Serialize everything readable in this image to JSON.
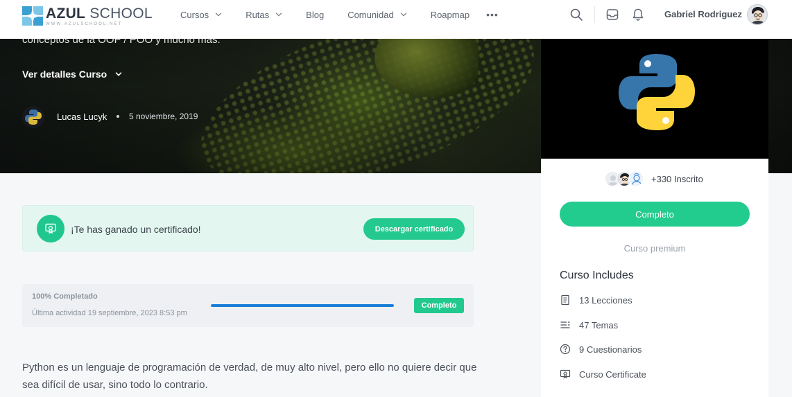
{
  "brand": {
    "name_bold": "AZUL",
    "name_light": "SCHOOL",
    "tagline": "WWW.AZULSCHOOL.NET"
  },
  "nav": {
    "items": [
      {
        "label": "Cursos",
        "has_dropdown": true
      },
      {
        "label": "Rutas",
        "has_dropdown": true
      },
      {
        "label": "Blog",
        "has_dropdown": false
      },
      {
        "label": "Comunidad",
        "has_dropdown": true
      },
      {
        "label": "Roapmap",
        "has_dropdown": false
      }
    ],
    "more": "•••"
  },
  "user": {
    "name": "Gabriel Rodriguez"
  },
  "hero": {
    "description": "conceptos de la OOP / POO y mucho mas.",
    "details_label": "Ver detalles Curso",
    "author": "Lucas Lucyk",
    "date": "5 noviembre, 2019"
  },
  "certificate": {
    "message": "¡Te has ganado un certificado!",
    "button": "Descargar certificado"
  },
  "progress": {
    "title": "100% Completado",
    "percent": 100,
    "last_activity": "Última actividad 19 septiembre, 2023 8:53 pm",
    "badge": "Completo"
  },
  "content": {
    "intro": "Python es un lenguaje de programación de verdad, de muy alto nivel, pero ello no quiere decir que sea difícil de usar, sino todo lo contrario."
  },
  "sidebar": {
    "enrolled": "+330 Inscrito",
    "button": "Completo",
    "premium": "Curso premium",
    "includes_title": "Curso Includes",
    "includes": [
      {
        "icon": "book-icon",
        "label": "13 Lecciones"
      },
      {
        "icon": "list-icon",
        "label": "47 Temas"
      },
      {
        "icon": "question-icon",
        "label": "9 Cuestionarios"
      },
      {
        "icon": "certificate-icon",
        "label": "Curso Certificate"
      }
    ]
  },
  "colors": {
    "accent_green": "#22cb8e",
    "progress_blue": "#1a7fd8",
    "logo_blue": "#3aa0d4"
  }
}
